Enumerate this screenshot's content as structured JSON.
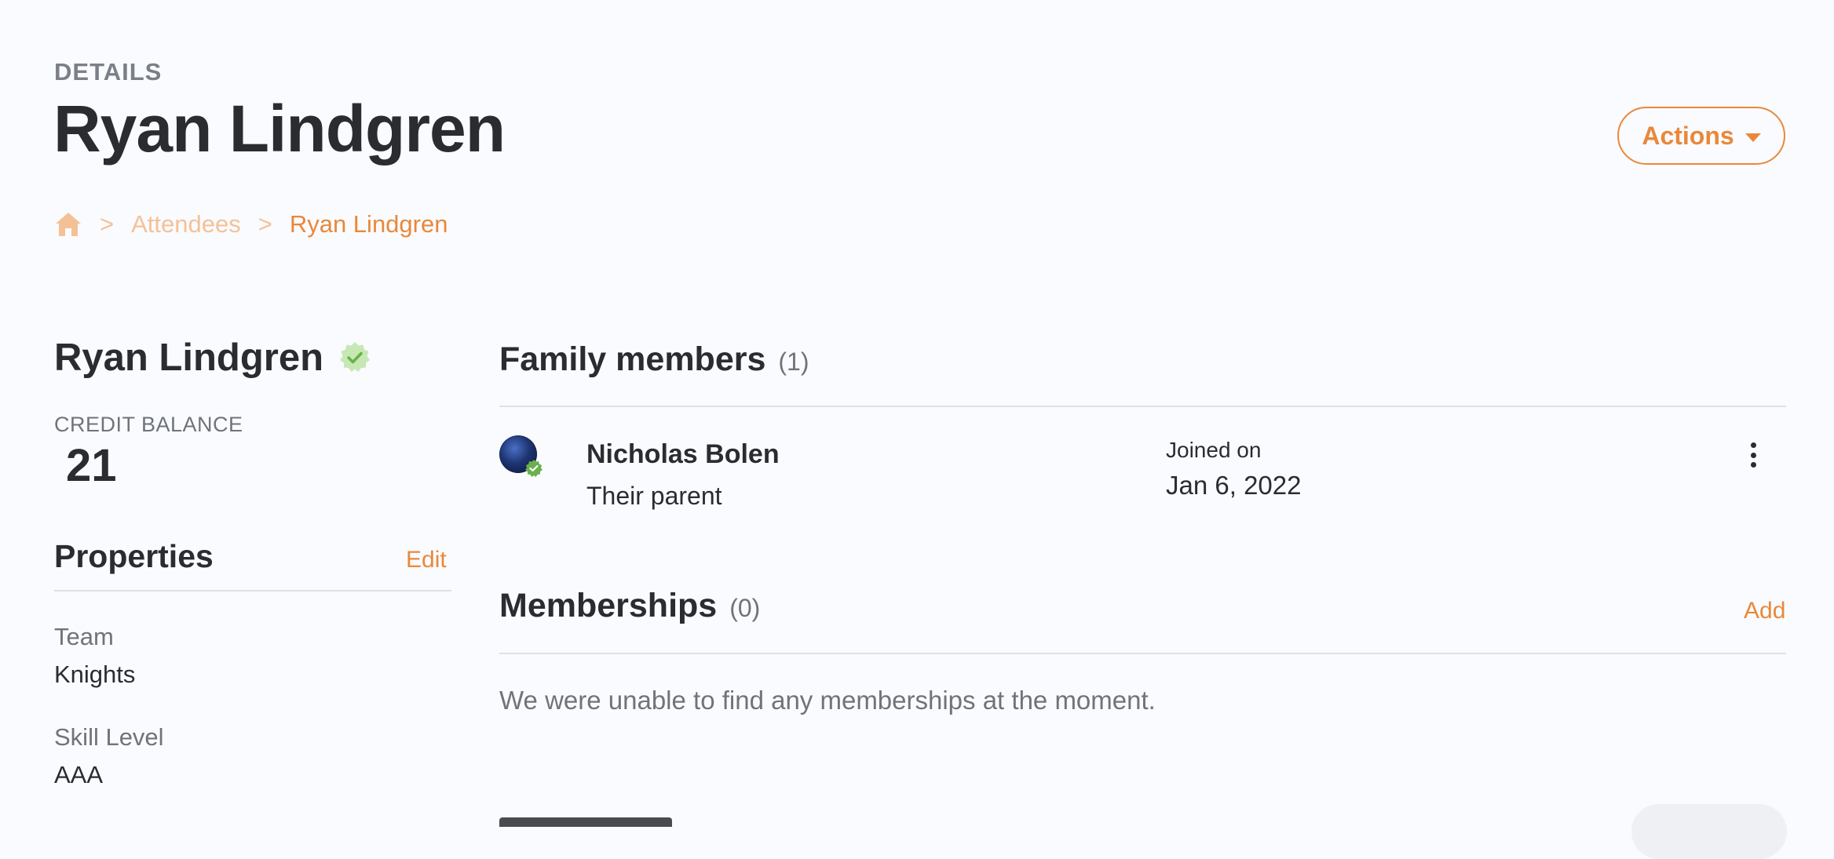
{
  "header": {
    "eyebrow": "DETAILS",
    "title": "Ryan Lindgren",
    "actions_label": "Actions"
  },
  "breadcrumb": {
    "home_icon": "home-icon",
    "separator": ">",
    "items": [
      "Attendees",
      "Ryan Lindgren"
    ]
  },
  "profile": {
    "name": "Ryan Lindgren",
    "verified_icon": "verified-badge-icon",
    "credit_label": "CREDIT BALANCE",
    "credit_value": "21"
  },
  "properties": {
    "title": "Properties",
    "edit_label": "Edit",
    "items": [
      {
        "label": "Team",
        "value": "Knights"
      },
      {
        "label": "Skill Level",
        "value": "AAA"
      }
    ]
  },
  "family": {
    "title": "Family members",
    "count": "(1)",
    "members": [
      {
        "name": "Nicholas Bolen",
        "relation": "Their parent",
        "joined_label": "Joined on",
        "joined_date": "Jan 6, 2022"
      }
    ]
  },
  "memberships": {
    "title": "Memberships",
    "count": "(0)",
    "add_label": "Add",
    "empty_message": "We were unable to find any memberships at the moment."
  },
  "colors": {
    "accent": "#e9883a",
    "accent_light": "#f4c197",
    "background": "#fafbfe",
    "verified": "#7cc25a"
  }
}
